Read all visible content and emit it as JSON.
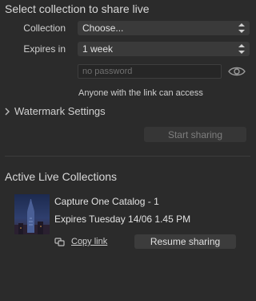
{
  "share_panel": {
    "title": "Select collection to share live",
    "collection": {
      "label": "Collection",
      "value": "Choose..."
    },
    "expires": {
      "label": "Expires in",
      "value": "1 week"
    },
    "password": {
      "placeholder": "no password",
      "icon": "eye-icon"
    },
    "access_note": "Anyone with the link can access",
    "watermark": {
      "label": "Watermark Settings",
      "icon": "chevron-right-icon"
    },
    "start_button": "Start sharing"
  },
  "active": {
    "title": "Active Live Collections",
    "items": [
      {
        "name": "Capture One Catalog - 1",
        "expires": "Expires Tuesday 14/06  1.45 PM",
        "copy_link": "Copy link",
        "resume_button": "Resume sharing"
      }
    ]
  },
  "colors": {
    "background": "#2b2b2b",
    "control": "#3a3a3a",
    "text": "#d6d6d6"
  }
}
